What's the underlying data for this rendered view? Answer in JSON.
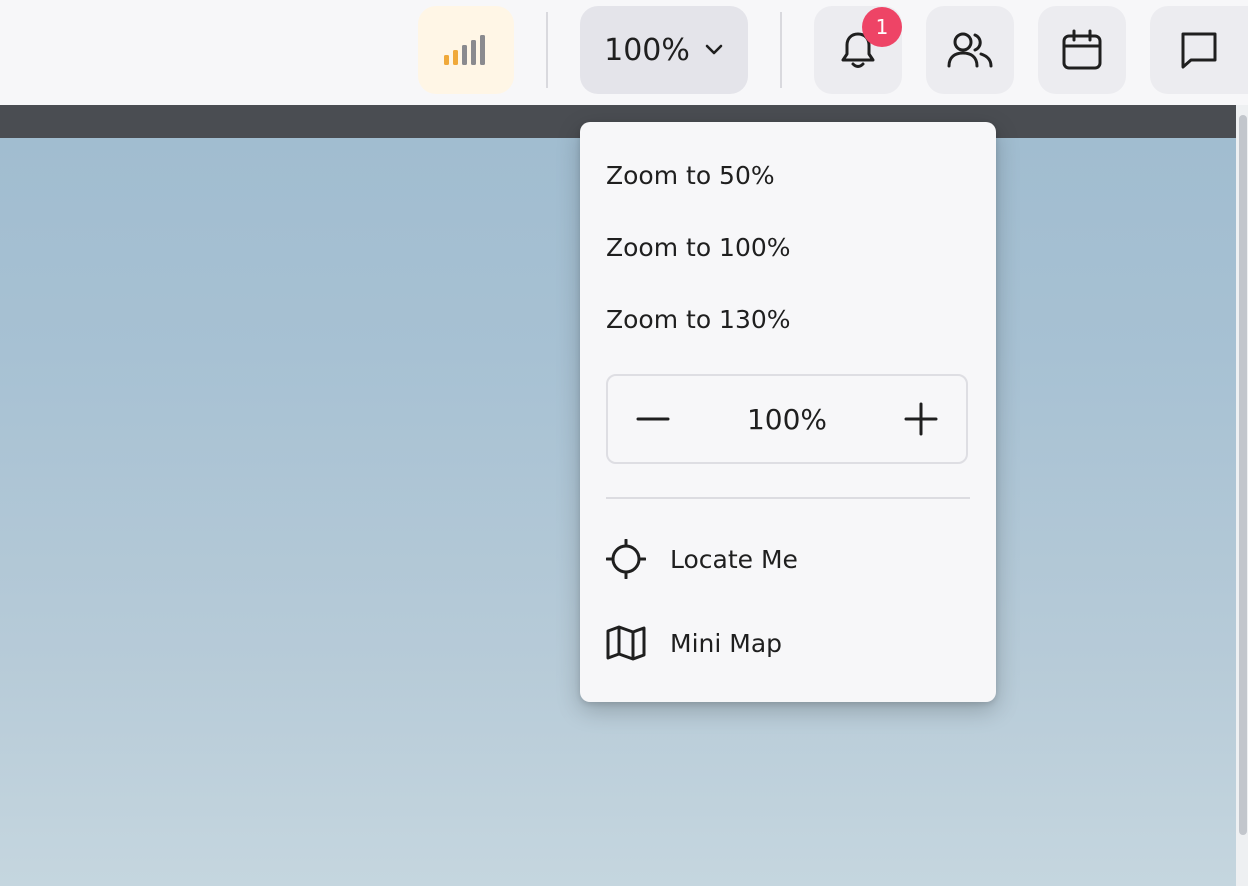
{
  "toolbar": {
    "zoom_label": "100%",
    "notification_count": "1",
    "signal_colors": {
      "active": "#f0a93a",
      "inactive": "#8a8a8f"
    },
    "icons": [
      "signal-strength-icon",
      "chevron-down-icon",
      "bell-icon",
      "users-icon",
      "calendar-icon",
      "chat-icon"
    ]
  },
  "zoom_menu": {
    "presets": [
      {
        "label": "Zoom to 50%"
      },
      {
        "label": "Zoom to 100%"
      },
      {
        "label": "Zoom to 130%"
      }
    ],
    "stepper_value": "100%",
    "actions": [
      {
        "label": "Locate Me",
        "icon": "crosshair-icon"
      },
      {
        "label": "Mini Map",
        "icon": "map-icon"
      }
    ]
  },
  "colors": {
    "badge": "#ee4466",
    "topbar": "#f7f7f9",
    "accent_signal": "#f0a93a"
  }
}
